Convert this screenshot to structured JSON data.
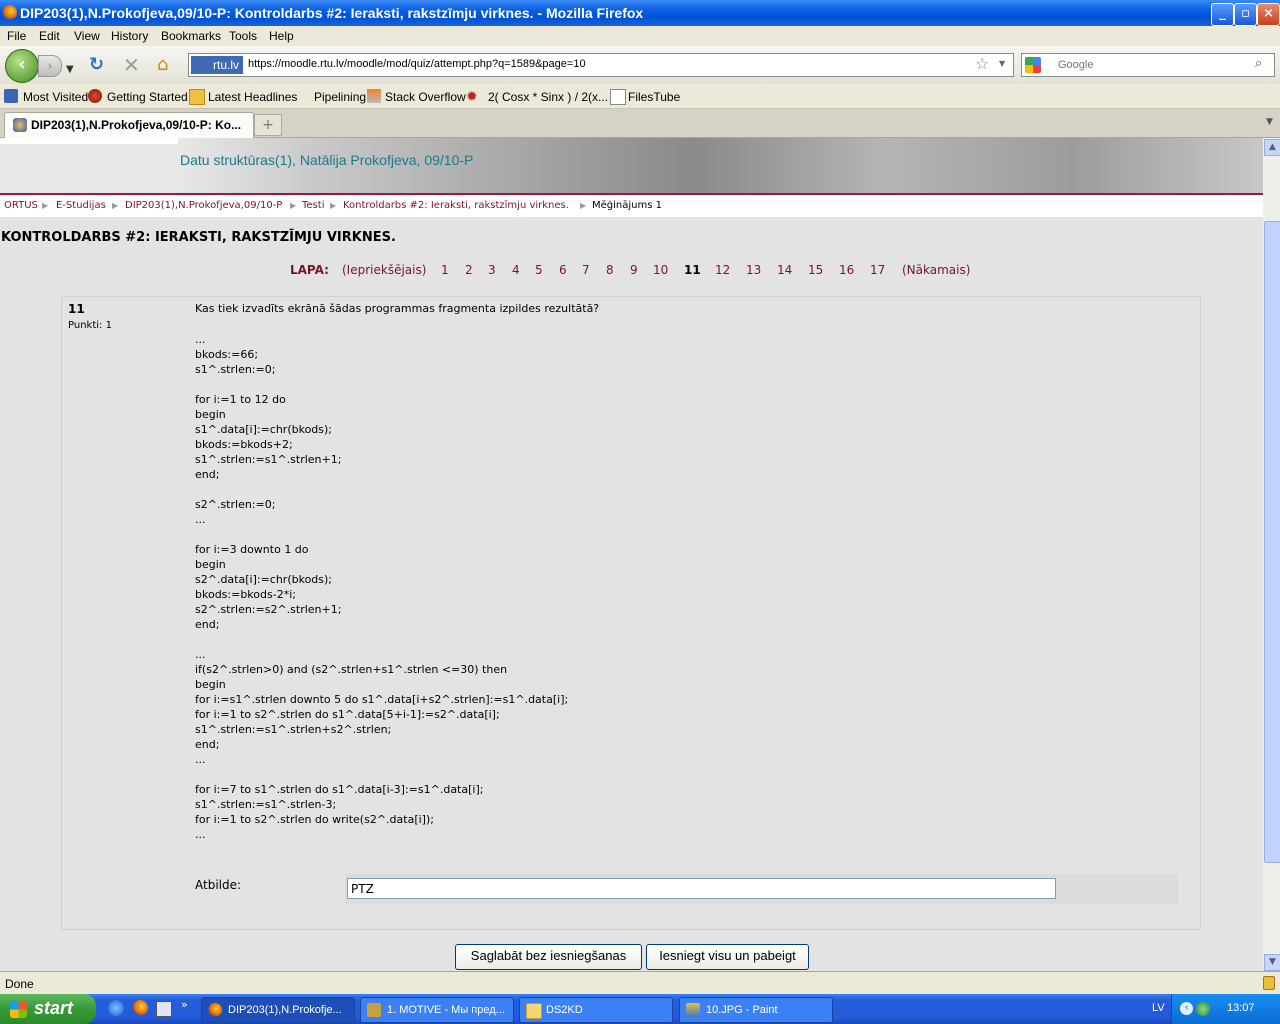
{
  "window": {
    "title": "DIP203(1),N.Prokofjeva,09/10-P: Kontroldarbs #2: Ieraksti, rakstzīmju virknes. - Mozilla Firefox"
  },
  "menu": [
    "File",
    "Edit",
    "View",
    "History",
    "Bookmarks",
    "Tools",
    "Help"
  ],
  "nav": {
    "site_badge": "rtu.lv",
    "url": "https://moodle.rtu.lv/moodle/mod/quiz/attempt.php?q=1589&page=10",
    "search_placeholder": "Google"
  },
  "bookmarks": [
    "Most Visited",
    "Getting Started",
    "Latest Headlines",
    "Pipelining",
    "Stack Overflow",
    "2( Cosx * Sinx ) / 2(x...",
    "FilesTube"
  ],
  "tab": {
    "label": "DIP203(1),N.Prokofjeva,09/10-P: Ko...",
    "new_tab": "+"
  },
  "page": {
    "course_title": "Datu struktūras(1), Natālija Prokofjeva, 09/10-P",
    "breadcrumbs": [
      "ORTUS",
      "E-Studijas",
      "DIP203(1),N.Prokofjeva,09/10-P",
      "Testi",
      "Kontroldarbs #2: Ieraksti, rakstzīmju virknes.",
      "Mēģinājums 1"
    ],
    "quiz_title": "KONTROLDARBS #2: IERAKSTI, RAKSTZĪMJU VIRKNES.",
    "pager": {
      "label": "LAPA:",
      "prev": "(Iepriekšējais)",
      "pages": [
        "1",
        "2",
        "3",
        "4",
        "5",
        "6",
        "7",
        "8",
        "9",
        "10",
        "11",
        "12",
        "13",
        "14",
        "15",
        "16",
        "17"
      ],
      "current": "11",
      "next": "(Nākamais)"
    },
    "question": {
      "number": "11",
      "points": "Punkti: 1",
      "text": "Kas tiek izvadīts ekrānā šādas programmas fragmenta izpildes rezultātā?",
      "code": "...\nbkods:=66;\ns1^.strlen:=0;\n\nfor i:=1 to 12 do\nbegin\ns1^.data[i]:=chr(bkods);\nbkods:=bkods+2;\ns1^.strlen:=s1^.strlen+1;\nend;\n\ns2^.strlen:=0;\n...\n\nfor i:=3 downto 1 do\nbegin\ns2^.data[i]:=chr(bkods);\nbkods:=bkods-2*i;\ns2^.strlen:=s2^.strlen+1;\nend;\n\n...\nif(s2^.strlen>0) and (s2^.strlen+s1^.strlen <=30) then\nbegin\nfor i:=s1^.strlen downto 5 do s1^.data[i+s2^.strlen]:=s1^.data[i];\nfor i:=1 to s2^.strlen do s1^.data[5+i-1]:=s2^.data[i];\ns1^.strlen:=s1^.strlen+s2^.strlen;\nend;\n...\n\nfor i:=7 to s1^.strlen do s1^.data[i-3]:=s1^.data[i];\ns1^.strlen:=s1^.strlen-3;\nfor i:=1 to s2^.strlen do write(s2^.data[i]);\n...",
      "answer_label": "Atbilde:",
      "answer_value": "PTZ"
    },
    "buttons": {
      "save": "Saglabāt bez iesniegšanas",
      "submit": "Iesniegt visu un pabeigt"
    }
  },
  "status": "Done",
  "taskbar": {
    "start": "start",
    "tasks": [
      "DIP203(1),N.Prokofje...",
      "1. MOTIVE - Мы пред...",
      "DS2KD",
      "10.JPG - Paint"
    ],
    "lang": "LV",
    "clock": "13:07"
  }
}
